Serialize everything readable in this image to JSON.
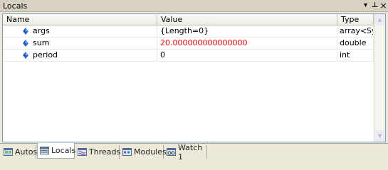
{
  "window": {
    "title": "Locals"
  },
  "titlebar_buttons": {
    "dropdown": "▾",
    "pin": "⊥",
    "close": "×"
  },
  "columns": [
    "Name",
    "Value",
    "Type"
  ],
  "rows": [
    {
      "name": "args",
      "value": "{Length=0}",
      "type": "array<Sy"
    },
    {
      "name": "sum",
      "value": "20.000000000000000",
      "type": "double",
      "value_color": "#e00000"
    },
    {
      "name": "period",
      "value": "0",
      "type": "int"
    }
  ],
  "scroll": {
    "up": "▲",
    "down": "▼"
  },
  "tabs": [
    {
      "label": "Autos",
      "icon": "autos-window-icon"
    },
    {
      "label": "Locals",
      "icon": "locals-window-icon",
      "active": true
    },
    {
      "label": "Threads",
      "icon": "threads-window-icon"
    },
    {
      "label": "Modules",
      "icon": "modules-window-icon"
    },
    {
      "label": "Watch 1",
      "icon": "watch-window-icon"
    }
  ],
  "colors": {
    "changed_value": "#e00000",
    "field_icon": "#2a63c8"
  }
}
